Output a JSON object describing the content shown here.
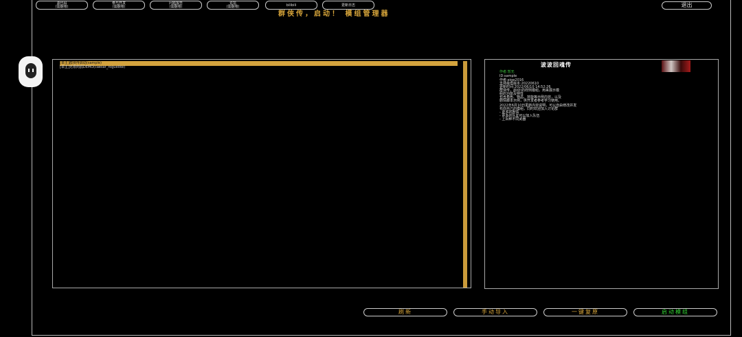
{
  "top_buttons": [
    {
      "line1": "源代码",
      "line2": "(需翻墙)"
    },
    {
      "line1": "参与开发",
      "line2": "(需翻墙)"
    },
    {
      "line1": "问题报告",
      "line2": "(需翻墙)"
    },
    {
      "line1": "论坛",
      "line2": "(需翻墙)"
    },
    {
      "line1": "bilibili",
      "line2": ""
    },
    {
      "line1": "更新日志",
      "line2": ""
    }
  ],
  "exit_label": "退出",
  "title": "群侠传，启动！  模组管理器",
  "mod_list": [
    {
      "label": "[单主]群侠传启动(sample)",
      "selected": true
    },
    {
      "label": "[单主]无限肉鸽DEMO(caesar_roguelike)",
      "selected": false
    }
  ],
  "detail": {
    "title": "波波回魂传",
    "lines": [
      {
        "text": "作者:暂无",
        "color": "green"
      },
      {
        "text": "ID:sample",
        "color": "normal"
      },
      {
        "text": "作者:eige2016",
        "color": "normal"
      },
      {
        "text": "支持最低版本:20220610",
        "color": "normal"
      },
      {
        "text": "更新时间:2022/06/10 14:52:26",
        "color": "normal"
      },
      {
        "text": "群侠传，启动!的样例模组，用来展示模",
        "color": "normal"
      },
      {
        "text": "组的功能及特性",
        "color": "normal"
      },
      {
        "text": "包含角色、物品、技能等示例内容，以及",
        "color": "normal"
      },
      {
        "text": "剧情脚本示例，供开发者参考学习使用。",
        "color": "normal"
      },
      {
        "text": "",
        "color": "normal"
      },
      {
        "text": "2022年6月10日更新内容说明，可以自由修改并发",
        "color": "normal"
      },
      {
        "text": "布你自己的模组，同时欢迎加入讨论群",
        "color": "normal"
      },
      {
        "text": "- 更多的剧情",
        "color": "normal"
      },
      {
        "text": "- 更多的队友可以加入队伍",
        "color": "normal"
      },
      {
        "text": "- 上百种不同武器",
        "color": "normal"
      }
    ]
  },
  "bottom_buttons": {
    "refresh": "刷新",
    "manual_import": "手动导入",
    "one_click_restore": "一键复原",
    "start_mod": "启动模组"
  }
}
